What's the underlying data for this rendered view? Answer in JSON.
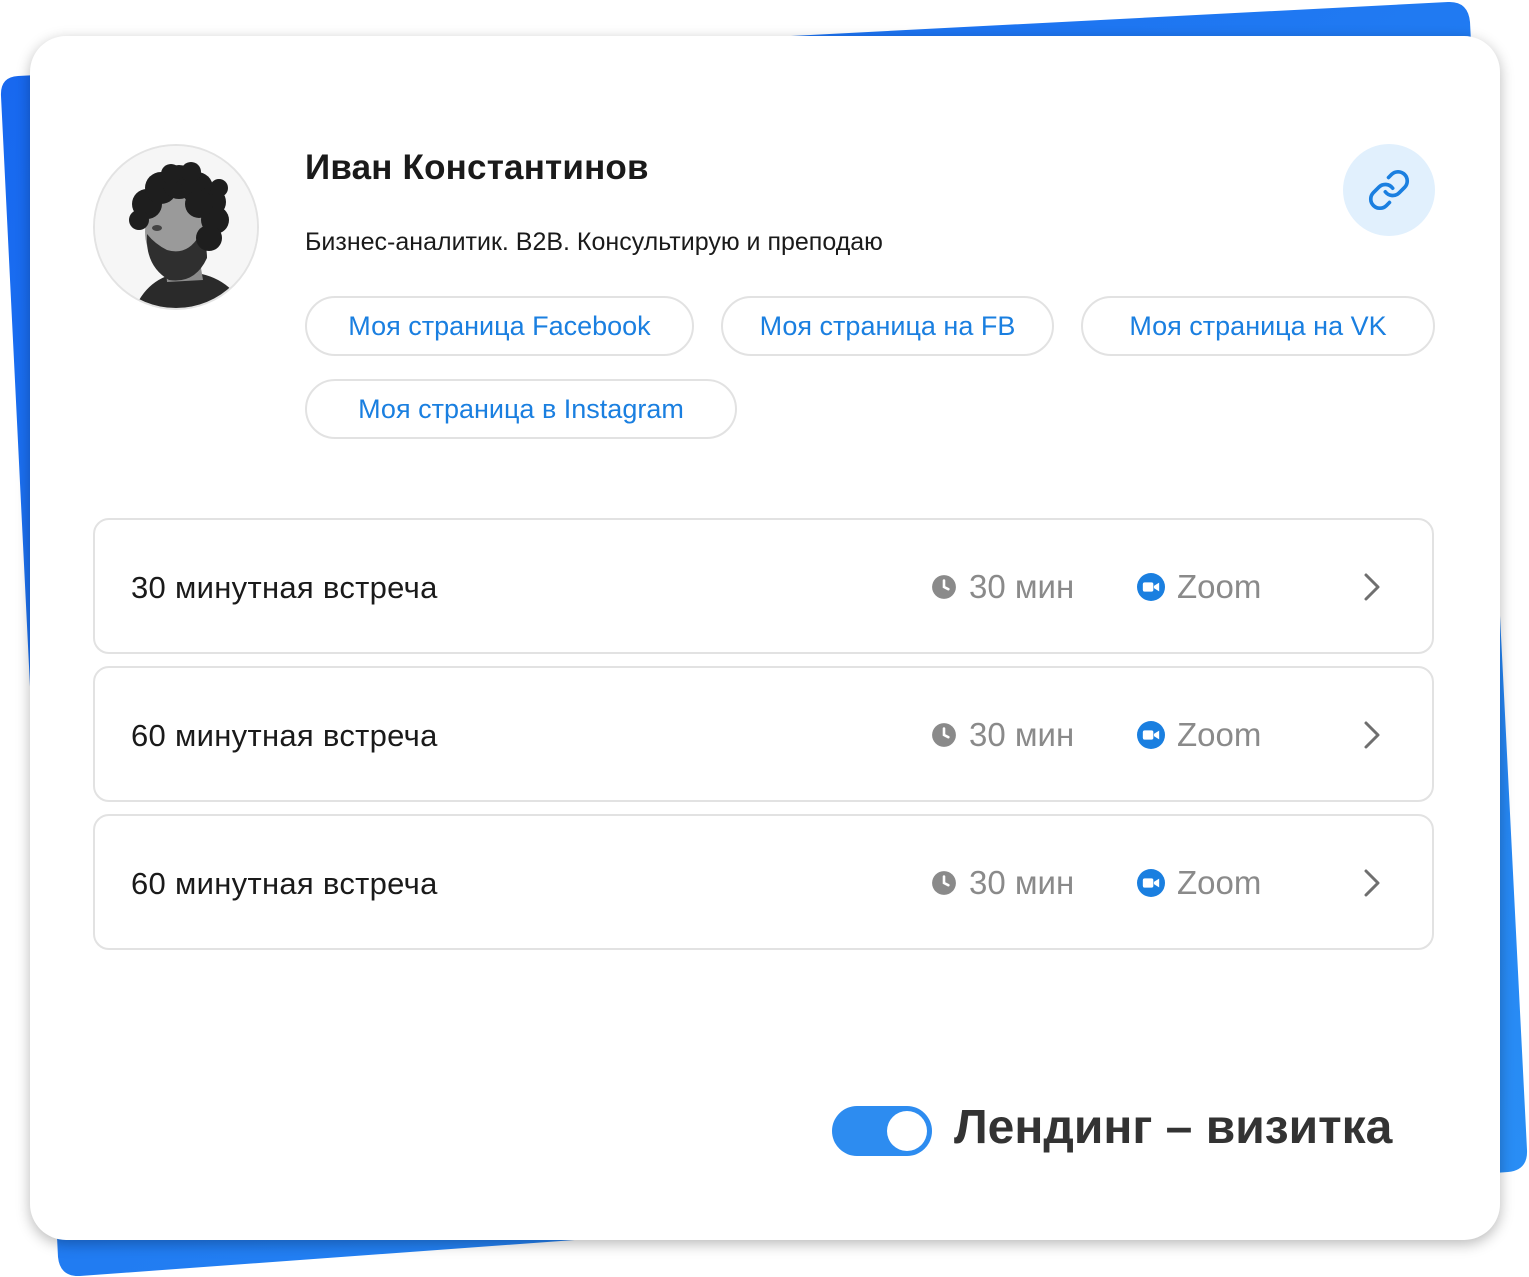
{
  "profile": {
    "name": "Иван Константинов",
    "bio": "Бизнес-аналитик. B2B. Консультирую и преподаю",
    "avatar_icon": "user-photo-icon",
    "copy_link_icon": "link-icon"
  },
  "social_links": [
    {
      "label": "Моя страница Facebook"
    },
    {
      "label": "Моя страница на FB"
    },
    {
      "label": "Моя страница на VK"
    },
    {
      "label": "Моя страница в Instagram"
    }
  ],
  "events": [
    {
      "title": "30 минутная встреча",
      "duration": "30 мин",
      "platform": "Zoom"
    },
    {
      "title": "60 минутная встреча",
      "duration": "30 мин",
      "platform": "Zoom"
    },
    {
      "title": "60 минутная встреча",
      "duration": "30 мин",
      "platform": "Zoom"
    }
  ],
  "toggle": {
    "label": "Лендинг – визитка",
    "state": "on"
  },
  "colors": {
    "accent": "#1a7fe0",
    "background_shape": "#1e6ff0",
    "toggle_on": "#2d8cf0",
    "muted_text": "#8a8a8a"
  }
}
